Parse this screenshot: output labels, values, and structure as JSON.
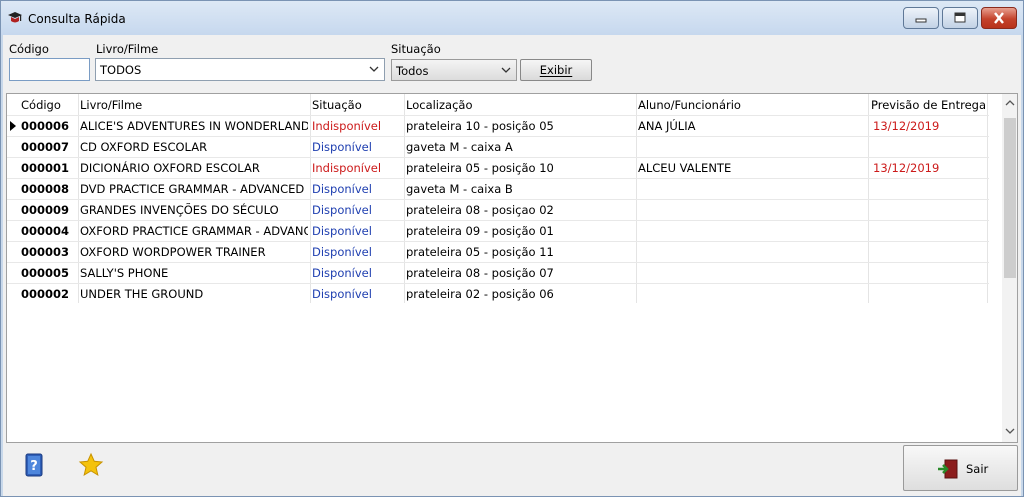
{
  "window": {
    "title": "Consulta Rápida"
  },
  "filters": {
    "codigo_label": "Código",
    "codigo_value": "",
    "livro_label": "Livro/Filme",
    "livro_value": "TODOS",
    "situacao_label": "Situação",
    "situacao_value": "Todos",
    "exibir_label": "Exibir"
  },
  "grid": {
    "columns": [
      "Código",
      "Livro/Filme",
      "Situação",
      "Localização",
      "Aluno/Funcionário",
      "Previsão de Entrega"
    ],
    "rows": [
      {
        "codigo": "000006",
        "titulo": "ALICE'S ADVENTURES IN WONDERLAND",
        "situacao": "Indisponível",
        "status": "unavailable",
        "localizacao": "prateleira 10 - posição 05",
        "aluno": "ANA JÚLIA",
        "previsao": "13/12/2019"
      },
      {
        "codigo": "000007",
        "titulo": "CD OXFORD ESCOLAR",
        "situacao": "Disponível",
        "status": "available",
        "localizacao": "gaveta M - caixa A",
        "aluno": "",
        "previsao": ""
      },
      {
        "codigo": "000001",
        "titulo": "DICIONÁRIO OXFORD ESCOLAR",
        "situacao": "Indisponível",
        "status": "unavailable",
        "localizacao": "prateleira 05 - posição 10",
        "aluno": "ALCEU VALENTE",
        "previsao": "13/12/2019"
      },
      {
        "codigo": "000008",
        "titulo": "DVD PRACTICE GRAMMAR - ADVANCED",
        "situacao": "Disponível",
        "status": "available",
        "localizacao": "gaveta M - caixa B",
        "aluno": "",
        "previsao": ""
      },
      {
        "codigo": "000009",
        "titulo": "GRANDES INVENÇÕES DO SÉCULO",
        "situacao": "Disponível",
        "status": "available",
        "localizacao": "prateleira 08 - posiçao 02",
        "aluno": "",
        "previsao": ""
      },
      {
        "codigo": "000004",
        "titulo": "OXFORD PRACTICE GRAMMAR - ADVANCED",
        "situacao": "Disponível",
        "status": "available",
        "localizacao": "prateleira 09 - posição 01",
        "aluno": "",
        "previsao": ""
      },
      {
        "codigo": "000003",
        "titulo": "OXFORD WORDPOWER TRAINER",
        "situacao": "Disponível",
        "status": "available",
        "localizacao": "prateleira 05 - posição 11",
        "aluno": "",
        "previsao": ""
      },
      {
        "codigo": "000005",
        "titulo": "SALLY'S PHONE",
        "situacao": "Disponível",
        "status": "available",
        "localizacao": "prateleira 08 - posição 07",
        "aluno": "",
        "previsao": ""
      },
      {
        "codigo": "000002",
        "titulo": "UNDER THE GROUND",
        "situacao": "Disponível",
        "status": "available",
        "localizacao": "prateleira 02 - posição 06",
        "aluno": "",
        "previsao": ""
      }
    ],
    "selected_row": 0
  },
  "footer": {
    "exit_label": "Sair",
    "help_icon": "help-book-icon",
    "favorite_icon": "star-icon"
  },
  "colors": {
    "unavailable": "#cc1a1a",
    "available": "#1f3fb0",
    "title_bar": "#c6d8ee"
  }
}
